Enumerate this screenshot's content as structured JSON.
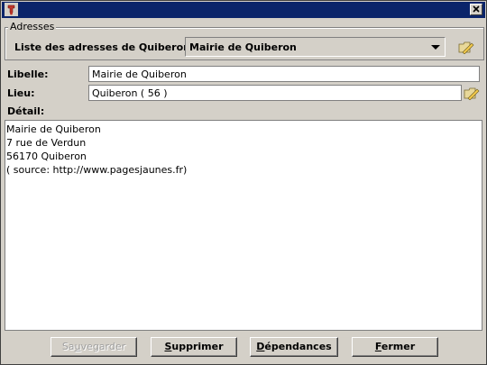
{
  "window": {
    "close_glyph": "✕"
  },
  "adresses": {
    "group_title": "Adresses",
    "list_label": "Liste des adresses de Quiberon:",
    "selected": "Mairie de Quiberon"
  },
  "form": {
    "libelle_label": "Libelle:",
    "libelle_value": "Mairie de Quiberon",
    "lieu_label": "Lieu:",
    "lieu_value": "Quiberon ( 56 )",
    "detail_label": "Détail:",
    "detail_lines": [
      "Mairie de Quiberon",
      "7 rue de Verdun",
      "56170 Quiberon",
      "( source: http://www.pagesjaunes.fr)"
    ]
  },
  "buttons": {
    "save": {
      "first": "Sa",
      "mnemonic": "u",
      "rest": "vegarder"
    },
    "delete": {
      "first": "",
      "mnemonic": "S",
      "rest": "upprimer"
    },
    "deps": {
      "first": "",
      "mnemonic": "D",
      "rest": "épendances"
    },
    "close": {
      "first": "",
      "mnemonic": "F",
      "rest": "ermer"
    }
  },
  "colors": {
    "titlebar": "#0a246a",
    "face": "#d4d0c8"
  },
  "icons": [
    "app-icon",
    "close-icon",
    "dropdown-arrow-icon",
    "folder-edit-icon"
  ]
}
